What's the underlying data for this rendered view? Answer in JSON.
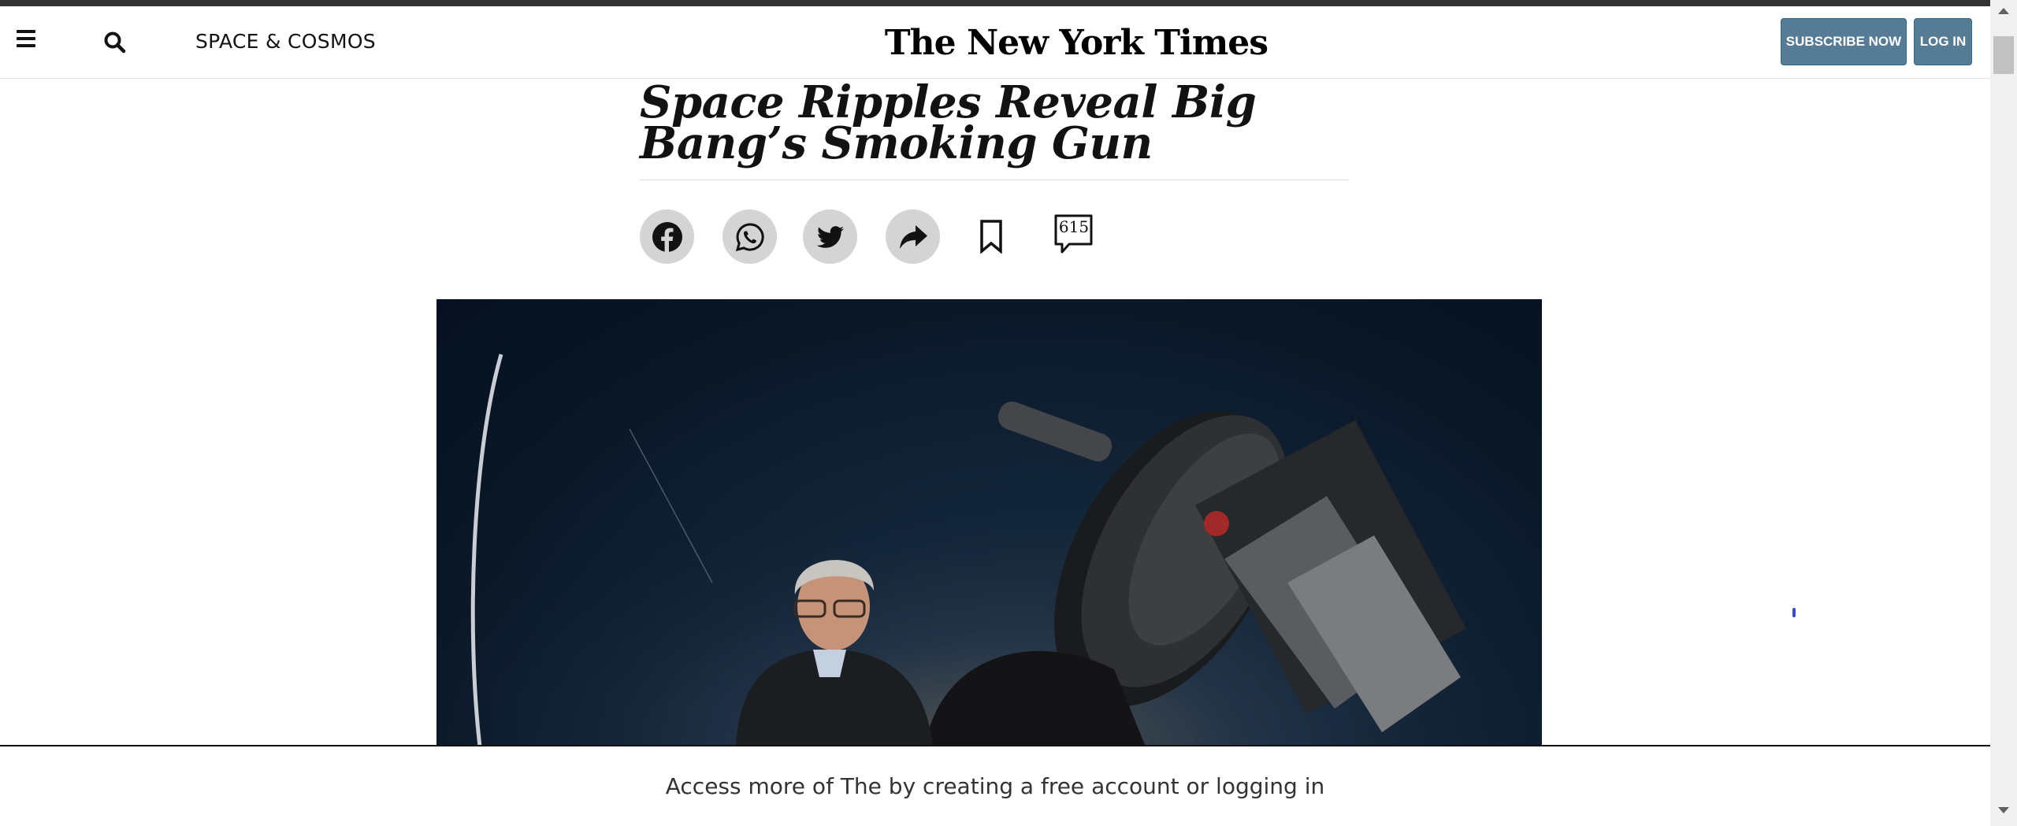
{
  "header": {
    "section_label": "SPACE & COSMOS",
    "logo_text": "The New York Times",
    "subscribe_label": "SUBSCRIBE NOW",
    "login_label": "LOG IN"
  },
  "article": {
    "headline": "Space Ripples Reveal Big Bang’s Smoking Gun",
    "comment_count": "615"
  },
  "share": {
    "icons": [
      "facebook-icon",
      "whatsapp-icon",
      "twitter-icon",
      "share-icon",
      "bookmark-icon",
      "comment-icon"
    ]
  },
  "footer_prompt": {
    "text": "Access more of The by creating a free account or logging in"
  },
  "colors": {
    "button_bg": "#567b95",
    "share_circle_bg": "#d4d4d4",
    "text_primary": "#121212"
  }
}
